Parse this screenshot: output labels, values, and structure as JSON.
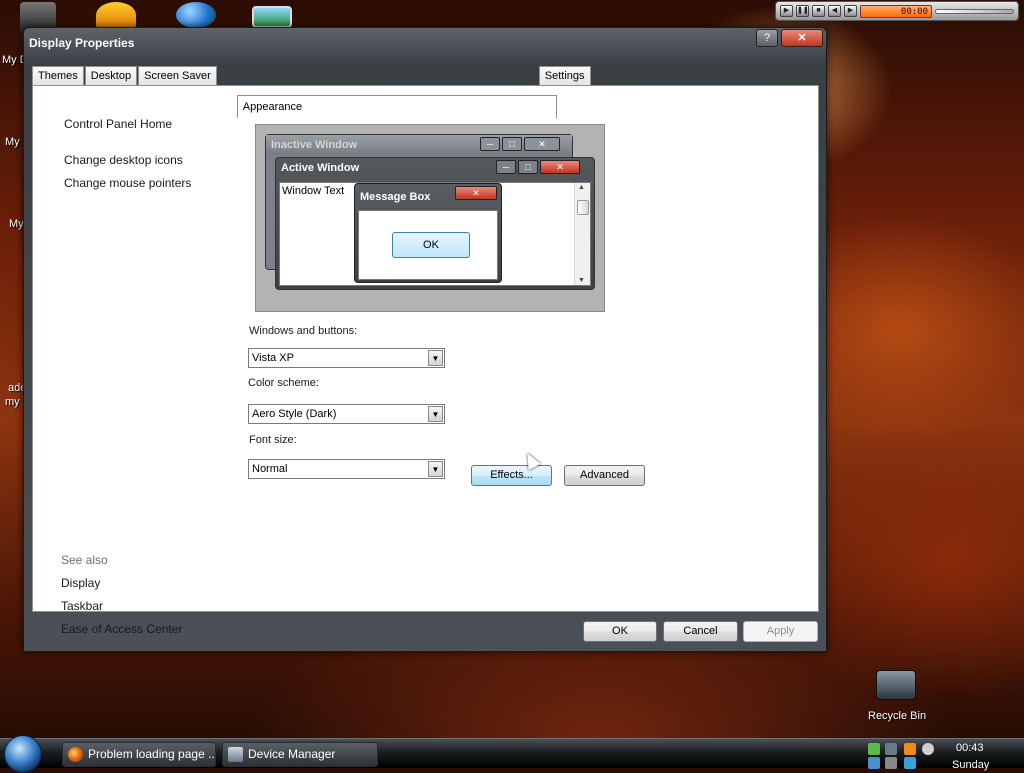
{
  "desktop": {
    "icons": [
      {
        "label": "My D"
      },
      {
        "label": "My"
      },
      {
        "label": "My"
      },
      {
        "label": "ade"
      },
      {
        "label": "my"
      }
    ],
    "recycle_bin": {
      "label": "Recycle Bin"
    }
  },
  "media_bar": {
    "time": "00:00"
  },
  "window": {
    "title": "Display Properties",
    "help_label": "?",
    "close_label": "✕",
    "tabs": [
      {
        "label": "Themes"
      },
      {
        "label": "Desktop"
      },
      {
        "label": "Screen Saver"
      },
      {
        "label": "Appearance",
        "active": true
      },
      {
        "label": "Settings"
      }
    ],
    "sidebar": {
      "links": [
        "Control Panel Home",
        "Change desktop icons",
        "Change mouse pointers"
      ],
      "see_also_label": "See also",
      "see_also_links": [
        "Display",
        "Taskbar",
        "Ease of Access Center"
      ]
    },
    "preview": {
      "inactive_title": "Inactive Window",
      "active_title": "Active Window",
      "window_text": "Window Text",
      "message_box_title": "Message Box",
      "message_ok": "OK"
    },
    "form": {
      "windows_buttons_label": "Windows and buttons:",
      "windows_buttons_value": "Vista XP",
      "color_scheme_label": "Color scheme:",
      "color_scheme_value": "Aero Style (Dark)",
      "font_size_label": "Font size:",
      "font_size_value": "Normal",
      "effects_label": "Effects...",
      "advanced_label": "Advanced"
    },
    "buttons": {
      "ok": "OK",
      "cancel": "Cancel",
      "apply": "Apply"
    }
  },
  "taskbar": {
    "tasks": [
      {
        "label": "Problem loading page ..."
      },
      {
        "label": "Device Manager"
      }
    ],
    "clock": "00:43",
    "day": "Sunday"
  },
  "colors": {
    "title_close": "#c23520",
    "button_hover": "#3c7fb1",
    "link_text": "#1a1a1a"
  }
}
